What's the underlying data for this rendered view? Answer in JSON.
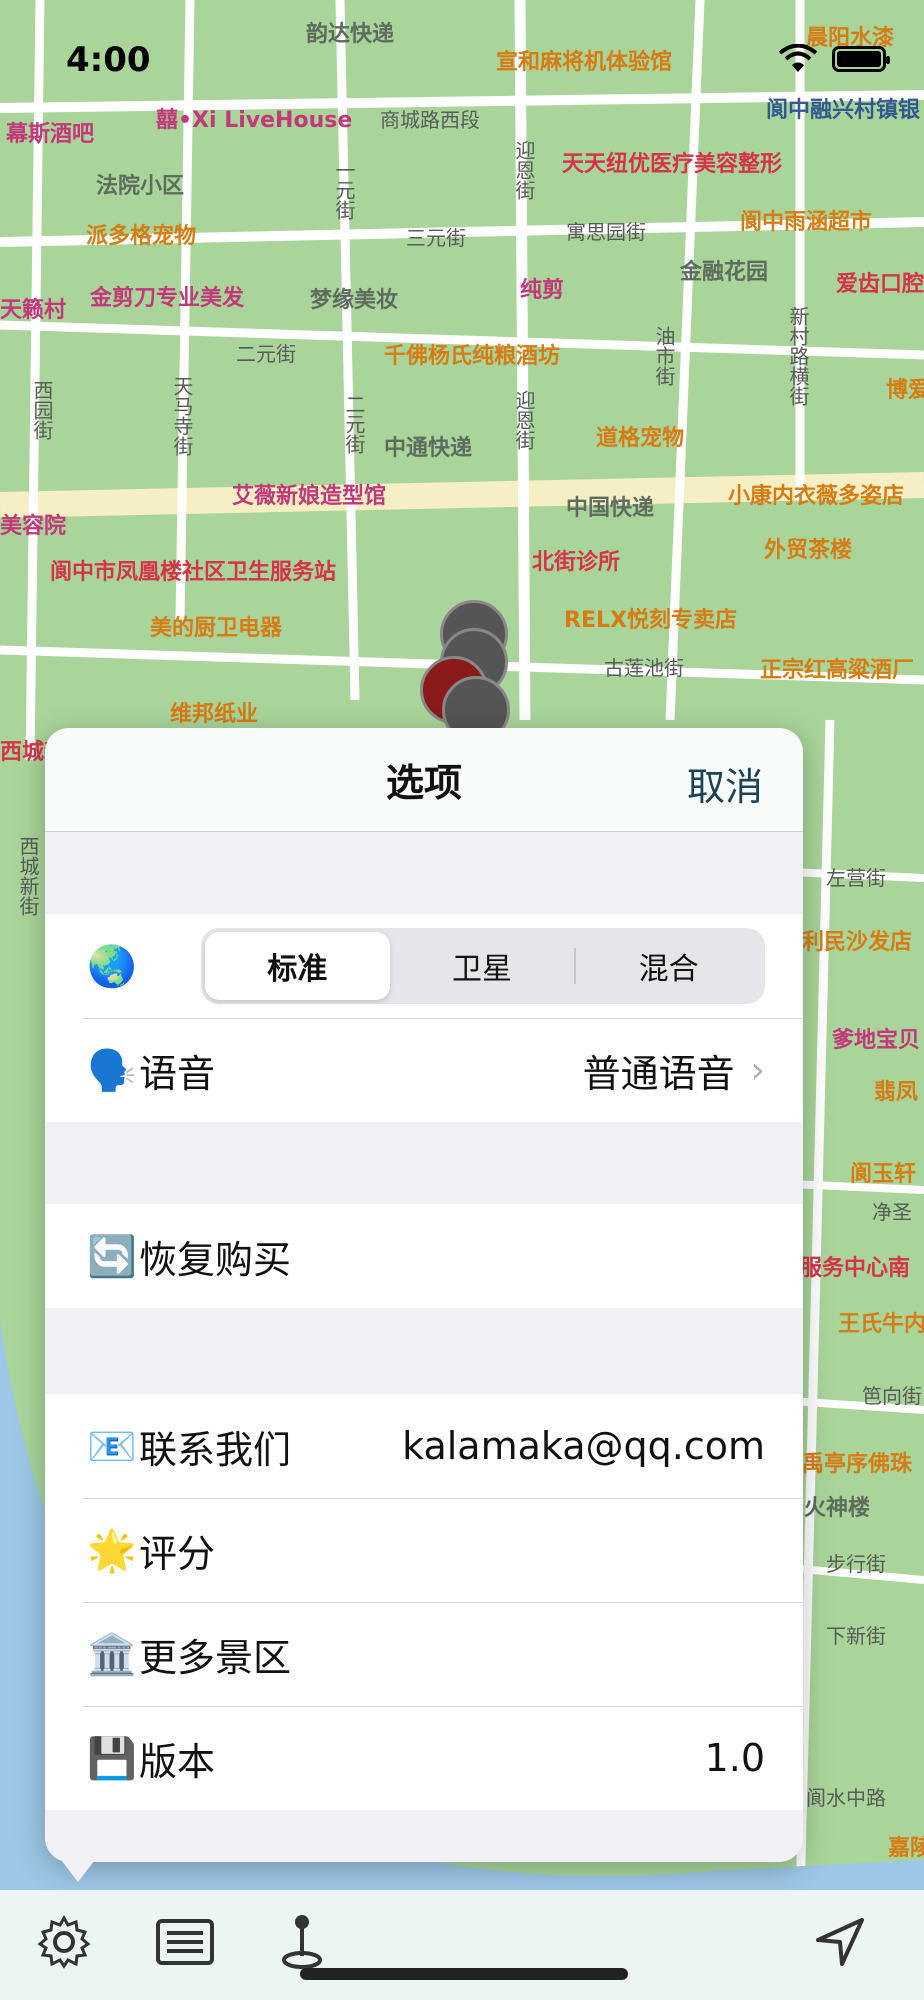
{
  "status_bar": {
    "time": "4:00"
  },
  "map": {
    "pois": [
      {
        "text": "韵达快递",
        "cls": "grey"
      },
      {
        "text": "宣和麻将机体验馆",
        "cls": "orange"
      },
      {
        "text": "晨阳水漆",
        "cls": "orange"
      },
      {
        "text": "囍•Xi LiveHouse",
        "cls": "pink"
      },
      {
        "text": "幕斯酒吧",
        "cls": "pink"
      },
      {
        "text": "商城路西段",
        "cls": "grey"
      },
      {
        "text": "阆中融兴村镇银",
        "cls": "blue"
      },
      {
        "text": "天天纽优医疗美容整形",
        "cls": "red"
      },
      {
        "text": "法院小区",
        "cls": "grey"
      },
      {
        "text": "派多格宠物",
        "cls": "orange"
      },
      {
        "text": "三元街",
        "cls": "grey"
      },
      {
        "text": "寓思园街",
        "cls": "grey"
      },
      {
        "text": "阆中雨涵超市",
        "cls": "orange"
      },
      {
        "text": "金融花园",
        "cls": "grey"
      },
      {
        "text": "爱齿口腔",
        "cls": "red"
      },
      {
        "text": "天籁村",
        "cls": "pink"
      },
      {
        "text": "金剪刀专业美发",
        "cls": "pink"
      },
      {
        "text": "梦缘美妆",
        "cls": "grey"
      },
      {
        "text": "纯剪",
        "cls": "pink"
      },
      {
        "text": "二元街",
        "cls": "grey"
      },
      {
        "text": "千佛杨氏纯粮酒坊",
        "cls": "orange"
      },
      {
        "text": "博爱",
        "cls": "orange"
      },
      {
        "text": "中通快递",
        "cls": "grey"
      },
      {
        "text": "道格宠物",
        "cls": "orange"
      },
      {
        "text": "艾薇新娘造型馆",
        "cls": "pink"
      },
      {
        "text": "中国快递",
        "cls": "grey"
      },
      {
        "text": "小康内衣薇多姿店",
        "cls": "orange"
      },
      {
        "text": "美容院",
        "cls": "pink"
      },
      {
        "text": "阆中市凤凰楼社区卫生服务站",
        "cls": "red"
      },
      {
        "text": "北街诊所",
        "cls": "red"
      },
      {
        "text": "外贸茶楼",
        "cls": "orange"
      },
      {
        "text": "美的厨卫电器",
        "cls": "orange"
      },
      {
        "text": "RELX悦刻专卖店",
        "cls": "orange"
      },
      {
        "text": "古莲池街",
        "cls": "grey"
      },
      {
        "text": "正宗红高粱酒厂",
        "cls": "orange"
      },
      {
        "text": "维邦纸业",
        "cls": "orange"
      },
      {
        "text": "西城新",
        "cls": "red"
      },
      {
        "text": "左营街",
        "cls": "grey"
      },
      {
        "text": "利民沙发店",
        "cls": "orange"
      },
      {
        "text": "爹地宝贝",
        "cls": "pink"
      },
      {
        "text": "翡凤",
        "cls": "orange"
      },
      {
        "text": "阆玉轩",
        "cls": "orange"
      },
      {
        "text": "净圣",
        "cls": "grey"
      },
      {
        "text": "服务中心南",
        "cls": "red"
      },
      {
        "text": "王氏牛内",
        "cls": "orange"
      },
      {
        "text": "笆向街",
        "cls": "grey"
      },
      {
        "text": "禹亭序佛珠",
        "cls": "orange"
      },
      {
        "text": "火神楼",
        "cls": "grey"
      },
      {
        "text": "步行街",
        "cls": "grey"
      },
      {
        "text": "下新街",
        "cls": "grey"
      },
      {
        "text": "阆水中路",
        "cls": "grey"
      },
      {
        "text": "嘉陵",
        "cls": "orange"
      }
    ],
    "roads_vertical": [
      "一元街",
      "迎恩街",
      "西园街",
      "天马寺街",
      "二元街",
      "迎恩街",
      "油市街",
      "新村路横街",
      "西城新街"
    ]
  },
  "sheet": {
    "title": "选项",
    "cancel": "取消",
    "map_type": {
      "icon": "🌏",
      "options": [
        "标准",
        "卫星",
        "混合"
      ],
      "selected": "标准"
    },
    "language": {
      "icon": "🗣️",
      "label": "语音",
      "value": "普通语音"
    },
    "restore": {
      "icon": "🔄",
      "label": "恢复购买"
    },
    "contact": {
      "icon": "📧",
      "label": "联系我们",
      "value": "kalamaka@qq.com"
    },
    "rate": {
      "icon": "🌟",
      "label": " 评分"
    },
    "more": {
      "icon": "🏛️",
      "label": "更多景区"
    },
    "version": {
      "icon": "💾",
      "label": "版本",
      "value": "1.0"
    }
  },
  "toolbar": {
    "settings_icon": "gear-icon",
    "list_icon": "list-icon",
    "route_icon": "pin-icon",
    "locate_icon": "location-arrow-icon"
  },
  "colors": {
    "map_green": "#a9d59a",
    "road": "#ffffff",
    "main_road": "#f6efc4",
    "river": "#9cc7e6",
    "accent": "#1c4259"
  }
}
